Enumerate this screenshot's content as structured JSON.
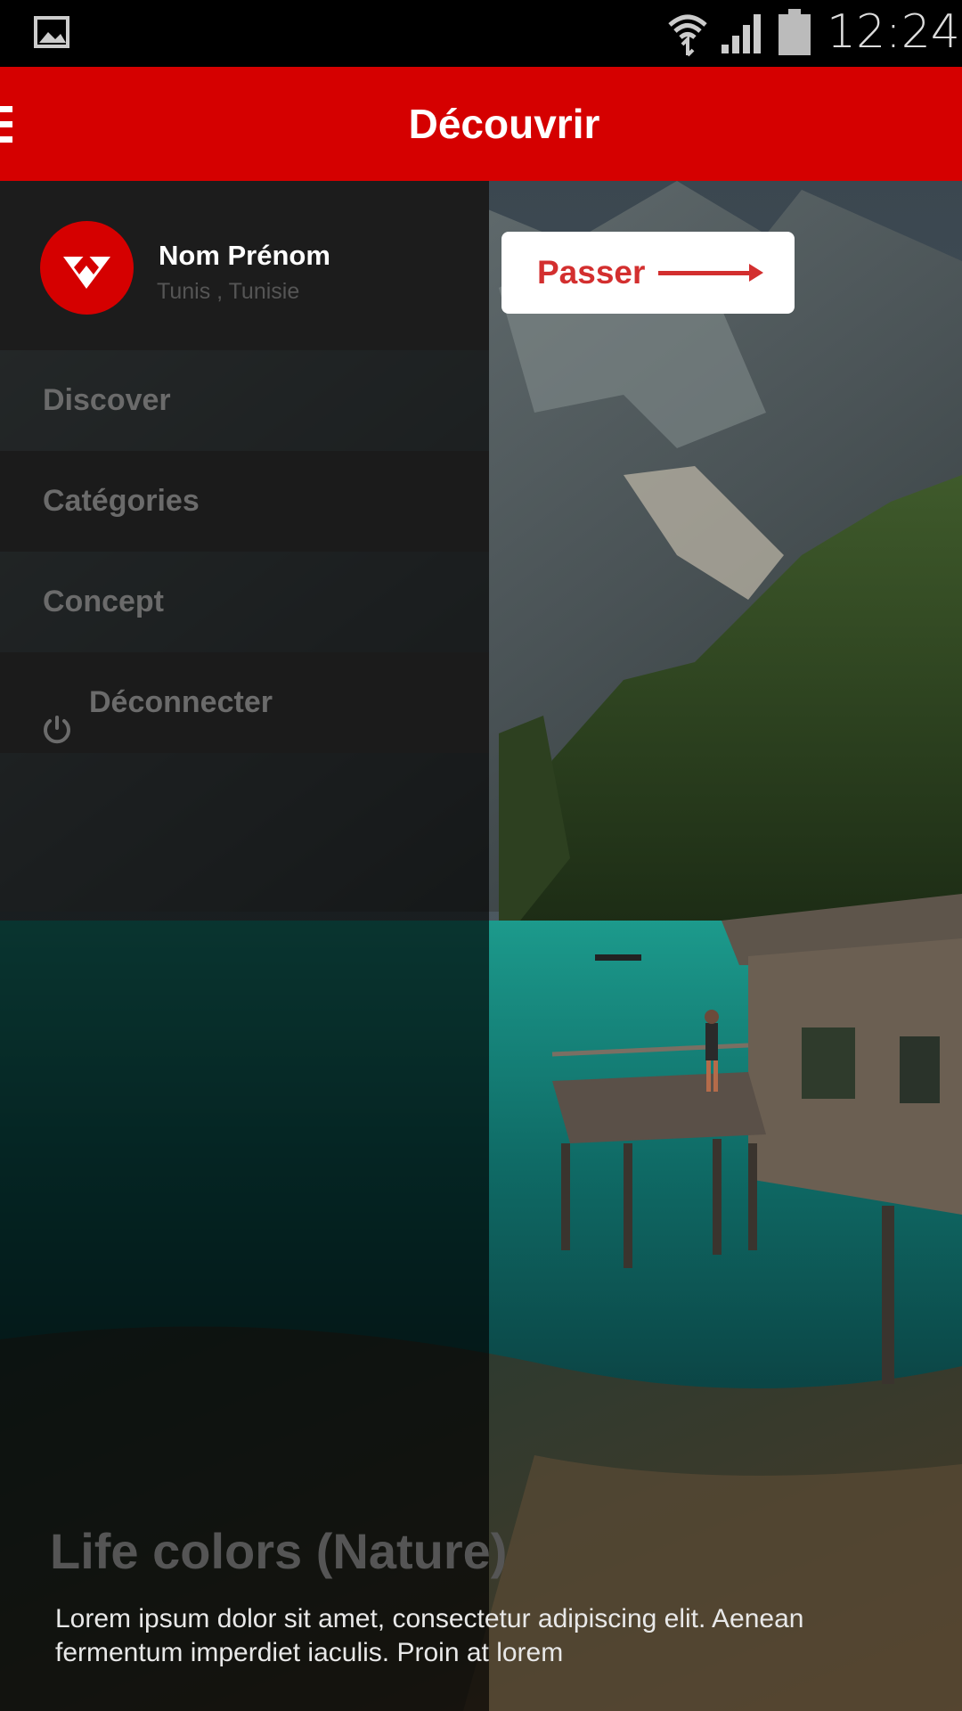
{
  "status_bar": {
    "time": "12:24",
    "icons": [
      "gallery-icon",
      "wifi-icon",
      "signal-icon",
      "battery-icon"
    ]
  },
  "app_bar": {
    "title": "Découvrir",
    "menu_icon": "hamburger-menu-icon"
  },
  "drawer": {
    "profile": {
      "name": "Nom Prénom",
      "location": "Tunis , Tunisie"
    },
    "items": [
      {
        "label": "Discover"
      },
      {
        "label": "Catégories"
      },
      {
        "label": "Concept"
      },
      {
        "label": "Déconnecter",
        "icon": "power-icon"
      }
    ]
  },
  "skip_button": {
    "label": "Passer",
    "icon": "arrow-right-icon"
  },
  "content": {
    "title": "Life colors (Nature)",
    "description": "Lorem ipsum dolor sit amet, consectetur adipiscing elit. Aenean fermentum imperdiet iaculis. Proin at lorem"
  },
  "colors": {
    "brand": "#d50000",
    "drawer_bg": "#1c1c1c",
    "accent_text": "#d32f2f"
  }
}
